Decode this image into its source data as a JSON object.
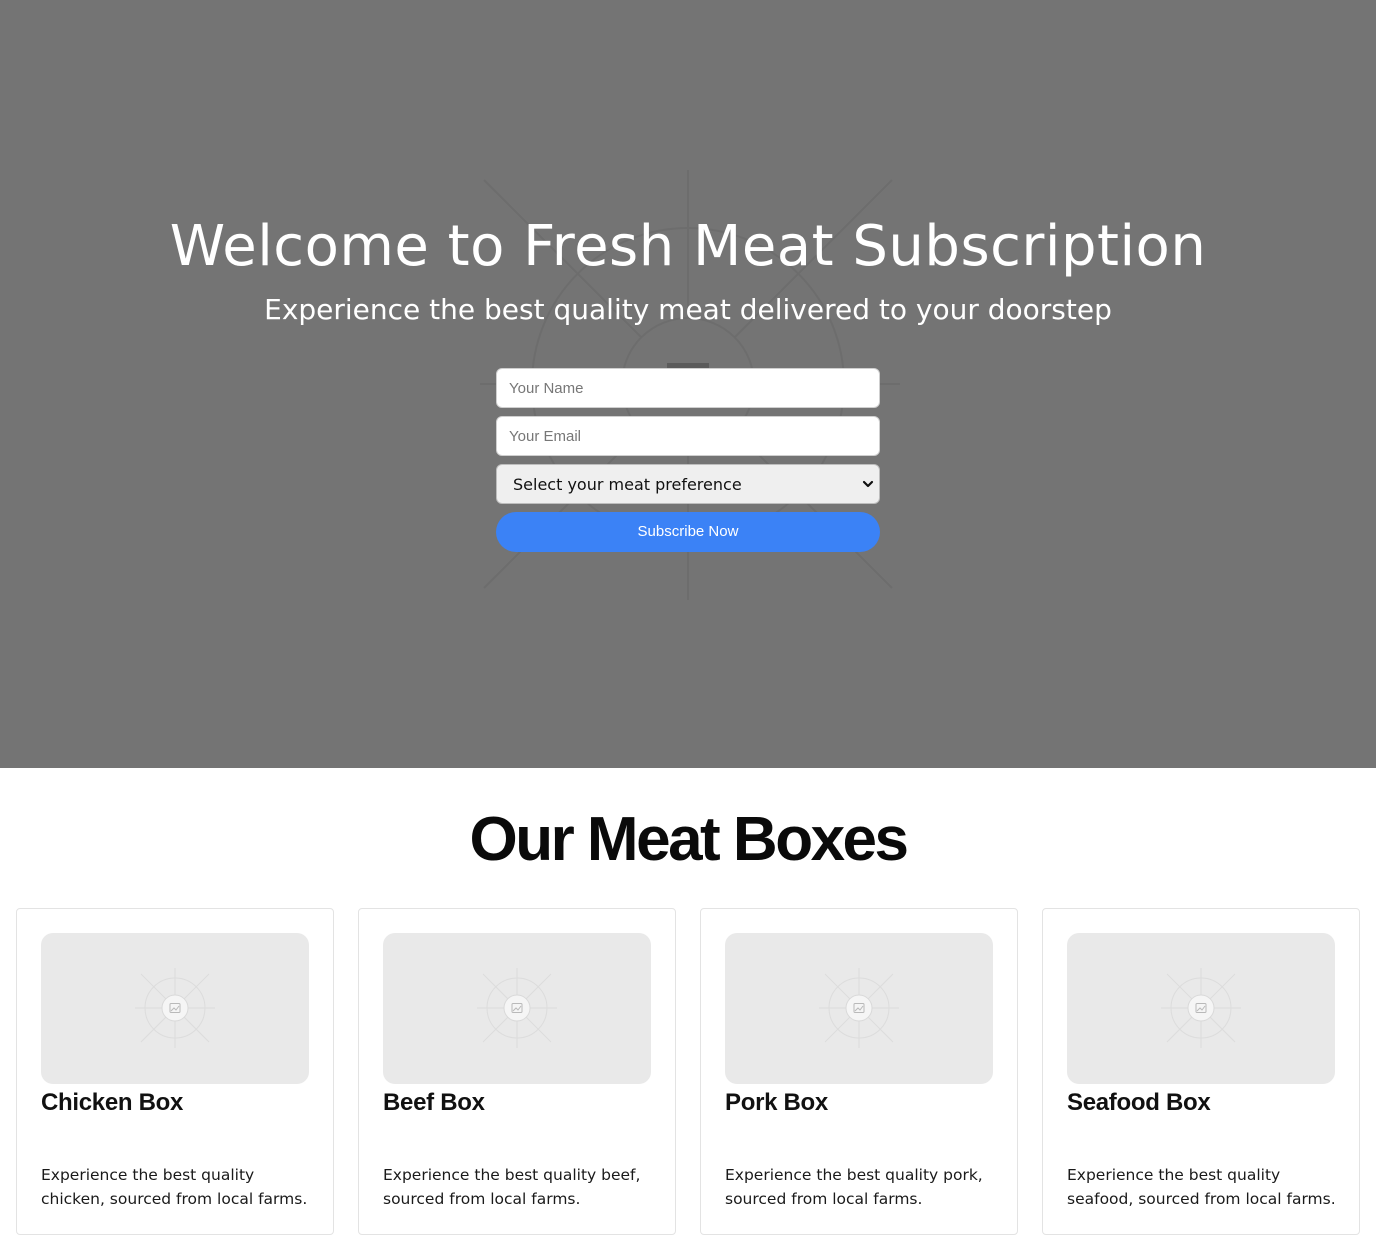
{
  "hero": {
    "title": "Welcome to Fresh Meat Subscription",
    "subtitle": "Experience the best quality meat delivered to your doorstep",
    "background_color": "#747474",
    "image_icon": "image-placeholder-icon"
  },
  "form": {
    "name_placeholder": "Your Name",
    "email_placeholder": "Your Email",
    "meat_select_value": "Select your meat preference",
    "subscribe_label": "Subscribe Now",
    "button_color": "#3b82f6",
    "chevron_icon": "chevron-down-icon"
  },
  "boxes": {
    "heading": "Our Meat Boxes",
    "items": [
      {
        "title": "Chicken Box",
        "description": "Experience the best quality chicken, sourced from local farms.",
        "image_icon": "image-placeholder-icon"
      },
      {
        "title": "Beef Box",
        "description": "Experience the best quality beef, sourced from local farms.",
        "image_icon": "image-placeholder-icon"
      },
      {
        "title": "Pork Box",
        "description": "Experience the best quality pork, sourced from local farms.",
        "image_icon": "image-placeholder-icon"
      },
      {
        "title": "Seafood Box",
        "description": "Experience the best quality seafood, sourced from local farms.",
        "image_icon": "image-placeholder-icon"
      }
    ]
  }
}
